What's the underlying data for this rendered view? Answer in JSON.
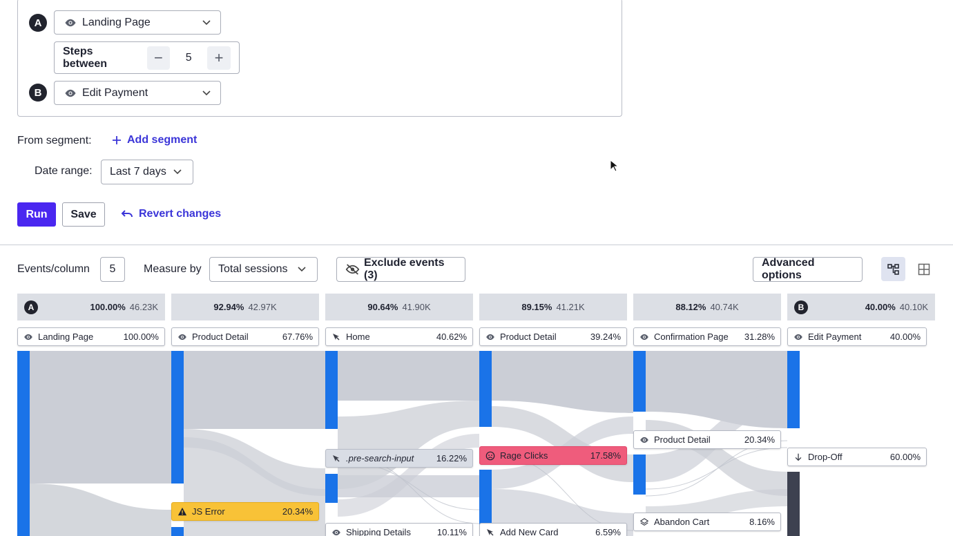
{
  "journey": {
    "step_a": {
      "badge": "A",
      "event": "Landing Page",
      "icon": "eye-icon"
    },
    "steps_between": {
      "label": "Steps between",
      "value": "5",
      "minus": "−",
      "plus": "+"
    },
    "step_b": {
      "badge": "B",
      "event": "Edit Payment",
      "icon": "eye-icon"
    }
  },
  "filters": {
    "segment_label": "From segment:",
    "add_segment": "Add segment",
    "date_label": "Date range:",
    "date_value": "Last 7 days"
  },
  "actions": {
    "run": "Run",
    "save": "Save",
    "revert": "Revert changes"
  },
  "toolbar": {
    "events_per_column_label": "Events/column",
    "events_per_column_value": "5",
    "measure_by_label": "Measure by",
    "measure_by_value": "Total sessions",
    "exclude_events": "Exclude events (3)",
    "advanced_options": "Advanced options"
  },
  "columns": [
    {
      "badge": "A",
      "pct": "100.00%",
      "count": "46.23K",
      "event": "Landing Page",
      "event_pct": "100.00%",
      "icon": "eye-icon"
    },
    {
      "badge": "",
      "pct": "92.94%",
      "count": "42.97K",
      "event": "Product Detail",
      "event_pct": "67.76%",
      "icon": "eye-icon"
    },
    {
      "badge": "",
      "pct": "90.64%",
      "count": "41.90K",
      "event": "Home",
      "event_pct": "40.62%",
      "icon": "cursor-icon"
    },
    {
      "badge": "",
      "pct": "89.15%",
      "count": "41.21K",
      "event": "Product Detail",
      "event_pct": "39.24%",
      "icon": "eye-icon"
    },
    {
      "badge": "",
      "pct": "88.12%",
      "count": "40.74K",
      "event": "Confirmation Page",
      "event_pct": "31.28%",
      "icon": "eye-icon"
    },
    {
      "badge": "B",
      "pct": "40.00%",
      "count": "40.10K",
      "event": "Edit Payment",
      "event_pct": "40.00%",
      "icon": "eye-icon"
    }
  ],
  "flow_nodes": [
    {
      "label": "JS Error",
      "pct": "20.34%",
      "icon": "warning-icon",
      "style": "yellow"
    },
    {
      "label": ".pre-search-input",
      "pct": "16.22%",
      "icon": "cursor-icon",
      "style": "light"
    },
    {
      "label": "Shipping Details",
      "pct": "10.11%",
      "icon": "eye-icon",
      "style": "white"
    },
    {
      "label": "Rage Clicks",
      "pct": "17.58%",
      "icon": "angry-face-icon",
      "style": "red"
    },
    {
      "label": "Add New Card",
      "pct": "6.59%",
      "icon": "cursor-icon",
      "style": "white"
    },
    {
      "label": "Product Detail",
      "pct": "20.34%",
      "icon": "eye-icon",
      "style": "white"
    },
    {
      "label": "Abandon Cart",
      "pct": "8.16%",
      "icon": "layers-icon",
      "style": "white"
    },
    {
      "label": "Drop-Off",
      "pct": "60.00%",
      "icon": "arrow-down-icon",
      "style": "white"
    }
  ],
  "colors": {
    "accent": "#4a27f0",
    "link": "#3b35d8",
    "bar": "#1a73e8",
    "flow": "#c9ccd4",
    "dropoff_bar": "#3d4150",
    "rage": "#ef5c7c",
    "error": "#f8c237"
  }
}
